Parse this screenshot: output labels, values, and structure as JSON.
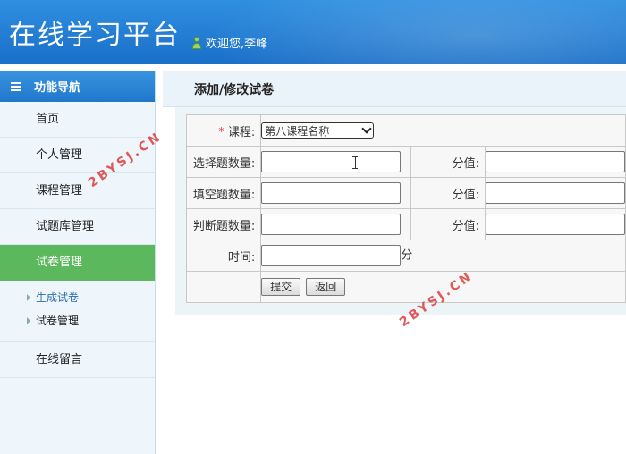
{
  "header": {
    "title": "在线学习平台",
    "welcome": "欢迎您,李峰"
  },
  "sidebar": {
    "title": "功能导航",
    "items": [
      {
        "label": "首页"
      },
      {
        "label": "个人管理"
      },
      {
        "label": "课程管理"
      },
      {
        "label": "试题库管理"
      },
      {
        "label": "试卷管理"
      }
    ],
    "sub_items": [
      {
        "label": "生成试卷"
      },
      {
        "label": "试卷管理"
      }
    ],
    "last_item": {
      "label": "在线留言"
    }
  },
  "main": {
    "title": "添加/修改试卷",
    "form": {
      "course_required_mark": "*",
      "course_label": "课程:",
      "course_selected": "第八课程名称",
      "choice_count_label": "选择题数量:",
      "choice_score_label": "分值:",
      "fill_count_label": "填空题数量:",
      "fill_score_label": "分值:",
      "judge_count_label": "判断题数量:",
      "judge_score_label": "分值:",
      "time_label": "时间:",
      "time_unit": "分",
      "submit_label": "提交",
      "back_label": "返回"
    }
  },
  "watermarks": [
    "2BYSJ.CN",
    "2BYSJ.CN"
  ],
  "colors": {
    "header": "#1f78cc",
    "active_nav": "#5cb85c",
    "required": "#e33333"
  }
}
